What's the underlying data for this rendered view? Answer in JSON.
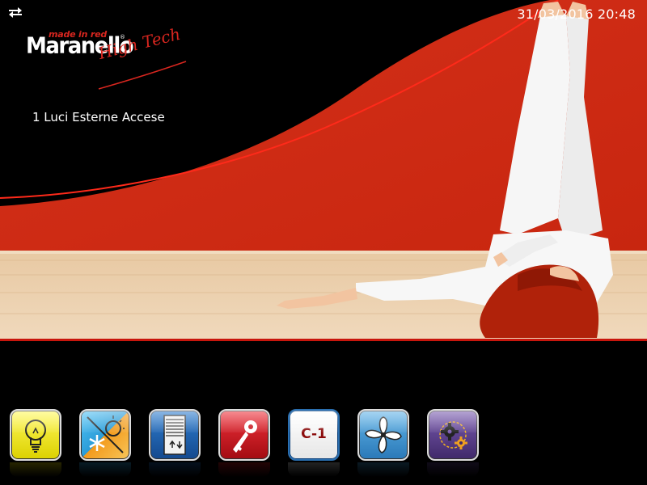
{
  "header": {
    "datetime": "31/03/2016 20:48",
    "network_icon": "network-arrows-icon"
  },
  "logo": {
    "tagline": "made in red",
    "brand": "Maranello",
    "registered": "®",
    "subtitle": "High Tech"
  },
  "status": {
    "text": "1 Luci Esterne Accese"
  },
  "toolbar": {
    "buttons": [
      {
        "name": "lights",
        "icon": "light-bulb-icon",
        "color": "#e8e000"
      },
      {
        "name": "climate",
        "icon": "sun-snowflake-icon",
        "color": "#2a9bd6"
      },
      {
        "name": "shutters",
        "icon": "shutter-icon",
        "color": "#1d5fa8"
      },
      {
        "name": "security",
        "icon": "key-icon",
        "color": "#c8161d"
      },
      {
        "name": "scenario",
        "icon": "c1-icon",
        "label": "C-1",
        "color": "#ffffff"
      },
      {
        "name": "ventilation",
        "icon": "fan-icon",
        "color": "#3a8fc8"
      },
      {
        "name": "settings",
        "icon": "gears-icon",
        "color": "#5a3f8a"
      }
    ]
  },
  "colors": {
    "accent_red": "#d8261f",
    "background": "#000000"
  }
}
